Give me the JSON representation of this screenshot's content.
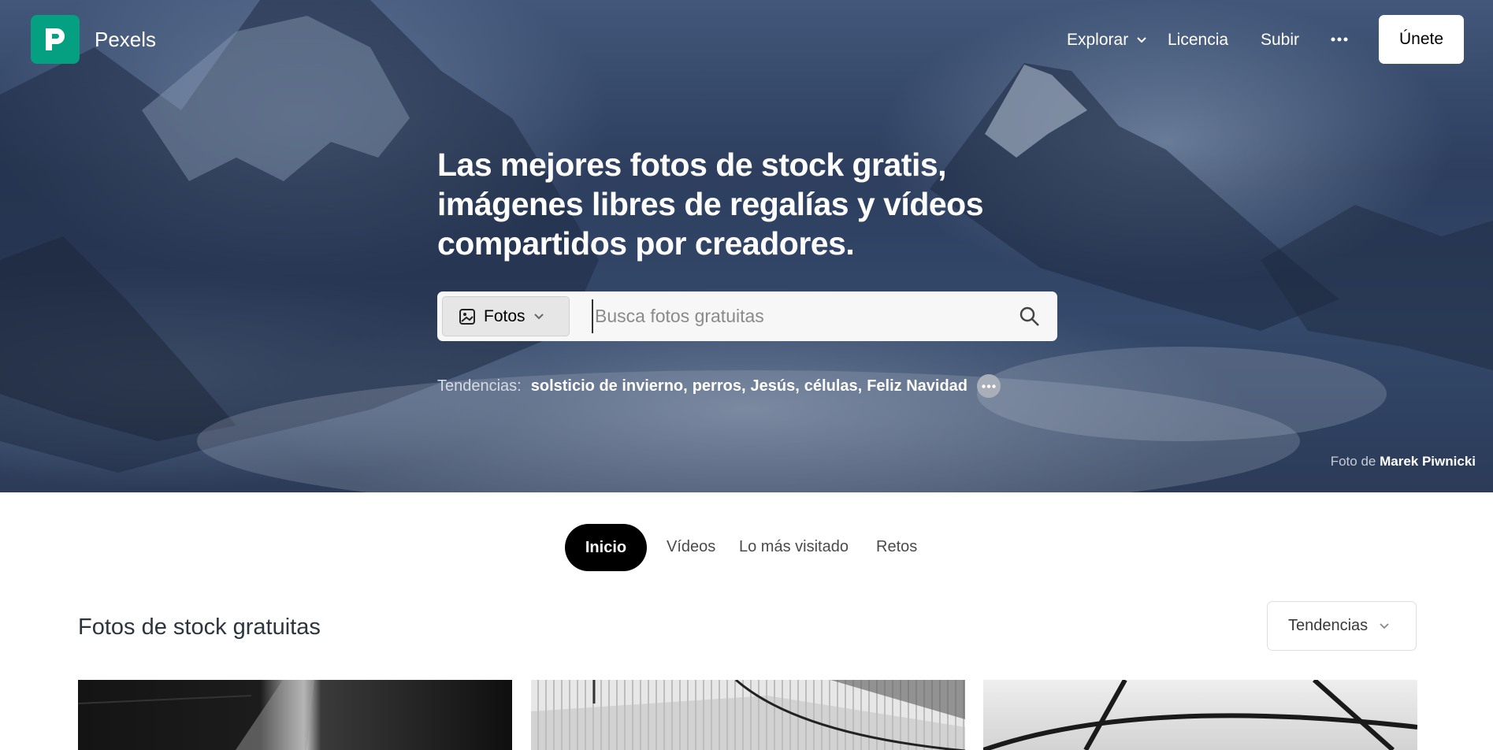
{
  "header": {
    "brand": "Pexels",
    "nav": {
      "explore": "Explorar",
      "license": "Licencia",
      "upload": "Subir"
    },
    "join_label": "Únete"
  },
  "hero": {
    "headline": "Las mejores fotos de stock gratis, imágenes libres de regalías y vídeos compartidos por creadores.",
    "search": {
      "type_label": "Fotos",
      "placeholder": "Busca fotos gratuitas",
      "value": ""
    },
    "trending": {
      "label": "Tendencias:",
      "terms": [
        "solsticio de invierno",
        "perros",
        "Jesús",
        "células",
        "Feliz Navidad"
      ]
    },
    "credit": {
      "prefix": "Foto de",
      "name": "Marek Piwnicki"
    }
  },
  "tabs": {
    "home": "Inicio",
    "videos": "Vídeos",
    "popular": "Lo más visitado",
    "challenges": "Retos"
  },
  "section": {
    "title": "Fotos de stock gratuitas",
    "sort_label": "Tendencias"
  },
  "colors": {
    "brand": "#05a081",
    "active_tab": "#000000"
  }
}
